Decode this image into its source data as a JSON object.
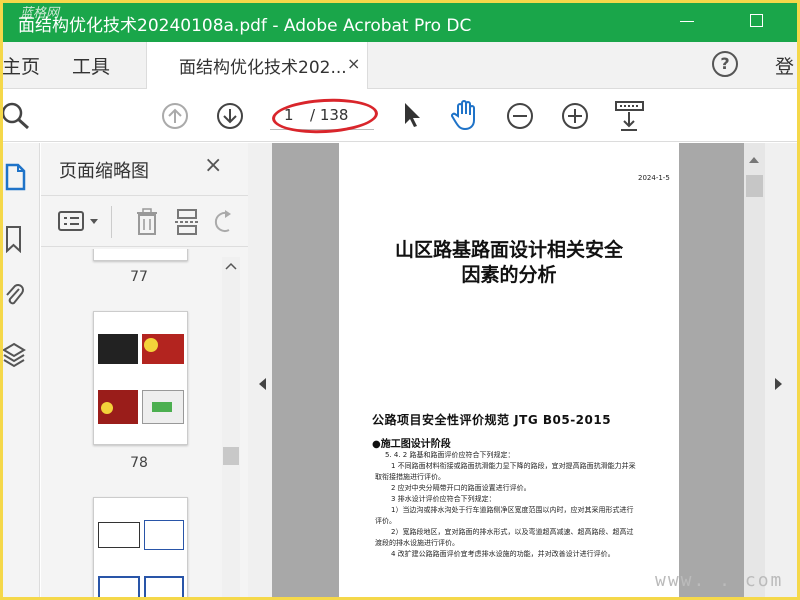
{
  "window": {
    "title": "面结构优化技术20240108a.pdf - Adobe Acrobat Pro DC",
    "watermark_top": "蓝格网"
  },
  "tabs": {
    "home": "主页",
    "tools": "工具",
    "document": "面结构优化技术202...",
    "close": "×",
    "help": "?",
    "login": "登"
  },
  "toolbar": {
    "current_page": "1",
    "total_pages": "/ 138"
  },
  "thumbnail_panel": {
    "title": "页面缩略图",
    "close": "×",
    "pages": [
      {
        "label": "77"
      },
      {
        "label": "78"
      }
    ]
  },
  "document": {
    "date": "2024-1-5",
    "title_line1": "山区路基路面设计相关安全",
    "title_line2": "因素的分析",
    "standard": "公路项目安全性评价规范 JTG B05-2015",
    "stage": "●施工图设计阶段",
    "lines": [
      "5. 4. 2   路基和路面评价应符合下列规定：",
      "1   不同路面材料衔接或路面抗滑能力显下降的路段，宜对提高路面抗滑能力并采",
      "取衔接措施进行评价。",
      "2   应对中央分隔带开口的路面设置进行评价。",
      "3   排水设计评价应符合下列规定：",
      "1）当边沟或排水沟处于行车道路侧净区宽度范围以内时，应对其采用形式进行",
      "评价。",
      "2）宽路段地区，宜对路面的排水形式，以及弯道超高减速、超高路段、超高过",
      "渡段的排水设施进行评价。",
      "4   改扩建公路路面评价宜考虑排水设施的功能，并对改善设计进行评价。"
    ]
  },
  "watermark_bottom": "www.    . com"
}
